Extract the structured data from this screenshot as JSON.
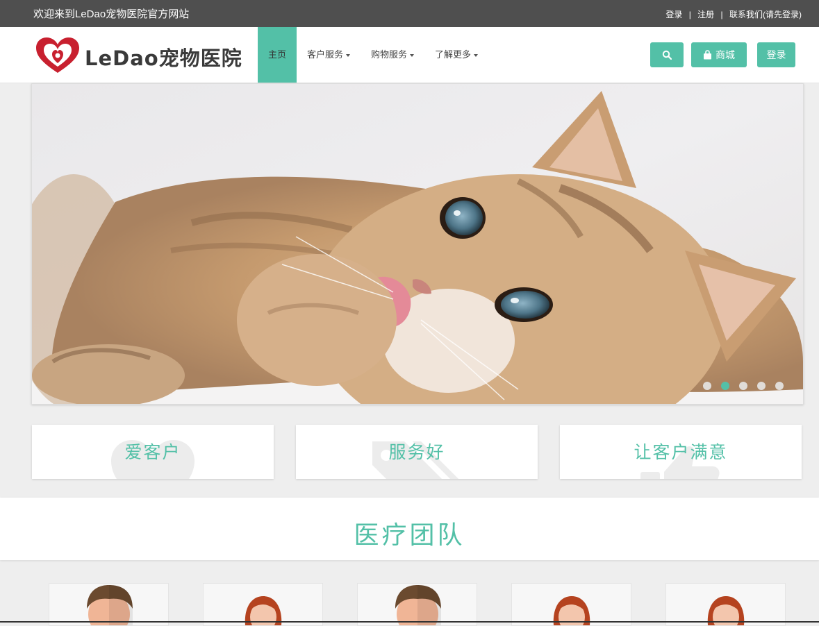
{
  "topbar": {
    "welcome": "欢迎来到LeDao宠物医院官方网站",
    "links": [
      "登录",
      "注册",
      "联系我们(请先登录)"
    ],
    "separator": "|"
  },
  "logo": {
    "text": "LeDao宠物医院"
  },
  "nav": {
    "items": [
      {
        "label": "主页",
        "active": true,
        "dropdown": false
      },
      {
        "label": "客户服务",
        "active": false,
        "dropdown": true
      },
      {
        "label": "购物服务",
        "active": false,
        "dropdown": true
      },
      {
        "label": "了解更多",
        "active": false,
        "dropdown": true
      }
    ]
  },
  "buttons": {
    "search_icon": "search-icon",
    "shop_label": "商城",
    "shop_icon": "shopping-bag-icon",
    "login_label": "登录"
  },
  "carousel": {
    "slide_count": 5,
    "active_index": 1
  },
  "features": [
    {
      "title": "爱客户",
      "icon": "heart-icon"
    },
    {
      "title": "服务好",
      "icon": "tag-icon"
    },
    {
      "title": "让客户满意",
      "icon": "thumbs-up-icon"
    }
  ],
  "team": {
    "title": "医疗团队",
    "members": [
      {
        "avatar": "male-doctor-avatar"
      },
      {
        "avatar": "female-doctor-avatar"
      },
      {
        "avatar": "male-doctor-avatar"
      },
      {
        "avatar": "female-doctor-avatar"
      },
      {
        "avatar": "female-doctor-avatar"
      }
    ]
  },
  "colors": {
    "accent": "#53c0a7",
    "topbar": "#4f4f4f",
    "page_bg": "#eeeeee",
    "logo_red": "#c8202f"
  }
}
